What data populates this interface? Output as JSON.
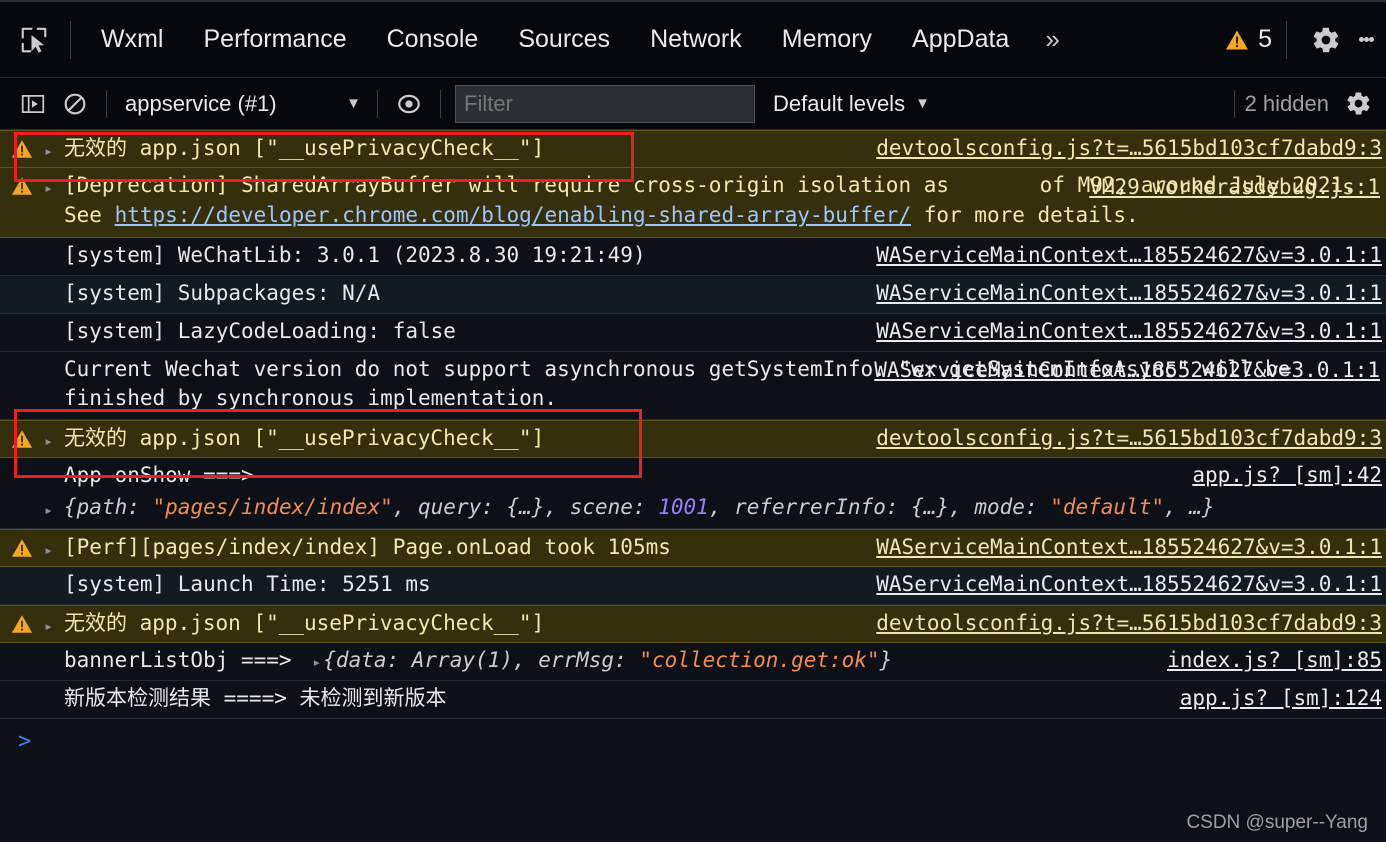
{
  "toolbar": {
    "inspect_icon": "inspect-cursor-icon",
    "tabs": [
      {
        "label": "Wxml"
      },
      {
        "label": "Performance"
      },
      {
        "label": "Console"
      },
      {
        "label": "Sources"
      },
      {
        "label": "Network"
      },
      {
        "label": "Memory"
      },
      {
        "label": "AppData"
      }
    ],
    "more_tabs": "»",
    "warning_count": "5",
    "warning_icon": "warning-triangle-icon",
    "settings_icon": "gear-icon",
    "menu_icon": "kebab-menu-icon"
  },
  "filterbar": {
    "sidebar_icon": "show-console-sidebar-icon",
    "clear_icon": "clear-console-icon",
    "context": "appservice (#1)",
    "context_caret": "▼",
    "eye_icon": "live-expression-eye-icon",
    "filter_value": "",
    "filter_placeholder": "Filter",
    "levels": "Default levels",
    "levels_caret": "▼",
    "hidden": "2 hidden",
    "settings_icon": "console-settings-gear-icon"
  },
  "console": {
    "rows": [
      {
        "id": "row-1",
        "type": "warning",
        "stripe": false,
        "icon": "warning-triangle-icon",
        "disclosure": "▸",
        "message": "无效的 app.json [\"__usePrivacyCheck__\"]",
        "source": "devtoolsconfig.js?t=…5615bd103cf7dabd9:3"
      },
      {
        "id": "row-2",
        "type": "warning",
        "stripe": false,
        "icon": "warning-triangle-icon",
        "disclosure": "▸",
        "message_parts": {
          "a": "[Deprecation] SharedArrayBuffer will require cross-origin isolation as ",
          "b": "of M92, around July 2021. See ",
          "link": "https://developer.chrome.com/blog/enabling-shared-array-buffer/",
          "c": " for more details."
        },
        "source": "VM29 workerasdebug.js:1"
      },
      {
        "id": "row-3",
        "type": "log",
        "stripe": false,
        "message": "[system] WeChatLib: 3.0.1 (2023.8.30 19:21:49)",
        "source": "WAServiceMainContext…185524627&v=3.0.1:1"
      },
      {
        "id": "row-4",
        "type": "log",
        "stripe": true,
        "message": "[system] Subpackages: N/A",
        "source": "WAServiceMainContext…185524627&v=3.0.1:1"
      },
      {
        "id": "row-5",
        "type": "log",
        "stripe": false,
        "message": "[system] LazyCodeLoading: false",
        "source": "WAServiceMainContext…185524627&v=3.0.1:1"
      },
      {
        "id": "row-6",
        "type": "log",
        "stripe": false,
        "message": "Current Wechat version do not support asynchronous getSystemInfo. \"wx.getSystemInfoAsync\" will be finished by synchronous implementation.",
        "source": "WAServiceMainContext…185524627&v=3.0.1:1"
      },
      {
        "id": "row-7",
        "type": "warning",
        "stripe": false,
        "icon": "warning-triangle-icon",
        "disclosure": "▸",
        "message": "无效的 app.json [\"__usePrivacyCheck__\"]",
        "source": "devtoolsconfig.js?t=…5615bd103cf7dabd9:3"
      },
      {
        "id": "row-8",
        "type": "log-object",
        "stripe": false,
        "message": "App onShow ===>",
        "object": {
          "open": "{",
          "k1": "path: ",
          "v1": "\"pages/index/index\"",
          "k2": ", query: {…}, scene: ",
          "v2": "1001",
          "k3": ", referrerInfo: {…}, mode: ",
          "v3": "\"default\"",
          "close": ", …}"
        },
        "disclosure": "▸",
        "source": "app.js? [sm]:42"
      },
      {
        "id": "row-9",
        "type": "warning",
        "stripe": false,
        "icon": "warning-triangle-icon",
        "disclosure": "▸",
        "message": "[Perf][pages/index/index] Page.onLoad took 105ms",
        "source": "WAServiceMainContext…185524627&v=3.0.1:1"
      },
      {
        "id": "row-10",
        "type": "log",
        "stripe": true,
        "message": "[system] Launch Time: 5251 ms",
        "source": "WAServiceMainContext…185524627&v=3.0.1:1"
      },
      {
        "id": "row-11",
        "type": "warning",
        "stripe": false,
        "icon": "warning-triangle-icon",
        "disclosure": "▸",
        "message": "无效的 app.json [\"__usePrivacyCheck__\"]",
        "source": "devtoolsconfig.js?t=…5615bd103cf7dabd9:3"
      },
      {
        "id": "row-12",
        "type": "log-object",
        "stripe": false,
        "message": "bannerListObj ===>",
        "object": {
          "open": "{",
          "k1": "data: Array(1), errMsg: ",
          "v1": "\"collection.get:ok\"",
          "close": "}"
        },
        "disclosure": "▸",
        "source": "index.js? [sm]:85"
      },
      {
        "id": "row-13",
        "type": "log",
        "stripe": false,
        "message": "新版本检测结果 ====> 未检测到新版本",
        "source": "app.js? [sm]:124"
      }
    ],
    "prompt_symbol": ">"
  },
  "annotations": {
    "box1_label": "highlight-box-first-privacy-warning",
    "box2_label": "highlight-box-second-privacy-warning",
    "watermark": "CSDN @super--Yang"
  },
  "colors": {
    "warning_row_bg": "#35300b",
    "warning_icon": "#f5a623",
    "highlight_border": "#ee1c25",
    "link": "#8ab4f8",
    "string": "#f28b54",
    "number": "#9a7dff"
  }
}
